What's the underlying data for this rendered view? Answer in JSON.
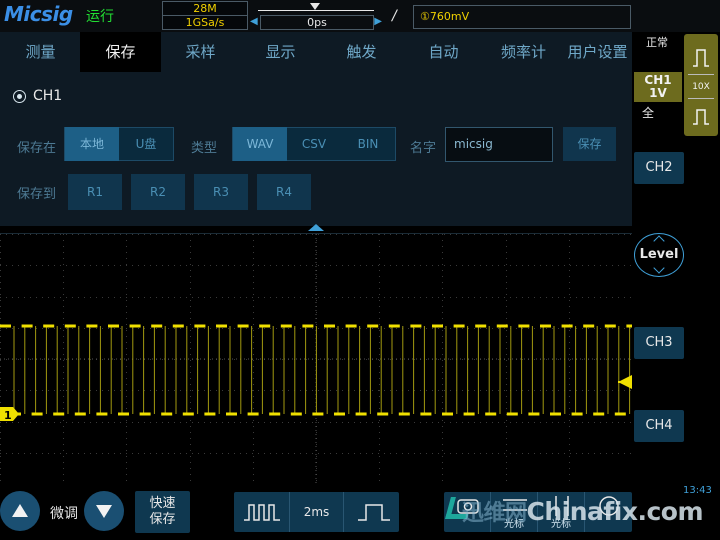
{
  "top": {
    "logo": "Micsig",
    "run_state": "运行",
    "record_length": "28M",
    "sample_rate": "1GSa/s",
    "time_offset": "0ps",
    "trigger_edge_icon": "rising-edge-icon",
    "trigger_level": "①760mV"
  },
  "menu": {
    "tabs": [
      "测量",
      "保存",
      "采样",
      "显示",
      "触发",
      "自动",
      "频率计",
      "用户设置"
    ],
    "active_index": 1
  },
  "save": {
    "channel": "CH1",
    "location_label": "保存在",
    "location_options": [
      "本地",
      "U盘"
    ],
    "location_selected": "本地",
    "type_label": "类型",
    "type_options": [
      "WAV",
      "CSV",
      "BIN"
    ],
    "type_selected": "WAV",
    "name_label": "名字",
    "name_value": "micsig",
    "save_button": "保存",
    "saveto_label": "保存到",
    "ref_slots": [
      "R1",
      "R2",
      "R3",
      "R4"
    ]
  },
  "waveform": {
    "channel_marker": "1",
    "color": "#f0e000",
    "trigger_marker_color": "#f0e000"
  },
  "right": {
    "coupling": "正常",
    "ch1_name": "CH1",
    "ch1_scale": "1V",
    "ch1_bandwidth": "全",
    "ch1_probe": "10X",
    "ch1_color": "#6d6b1e",
    "ch2": "CH2",
    "level": "Level",
    "ch3": "CH3",
    "ch4": "CH4"
  },
  "bottom": {
    "fine_label": "微调",
    "quick_save": "快速保存",
    "timebase": "2ms",
    "tool_labels": [
      "",
      "光标",
      "光标",
      ""
    ],
    "clock": "13:43",
    "watermark": "Chinafix.com",
    "watermark_cn": "迅维网"
  }
}
